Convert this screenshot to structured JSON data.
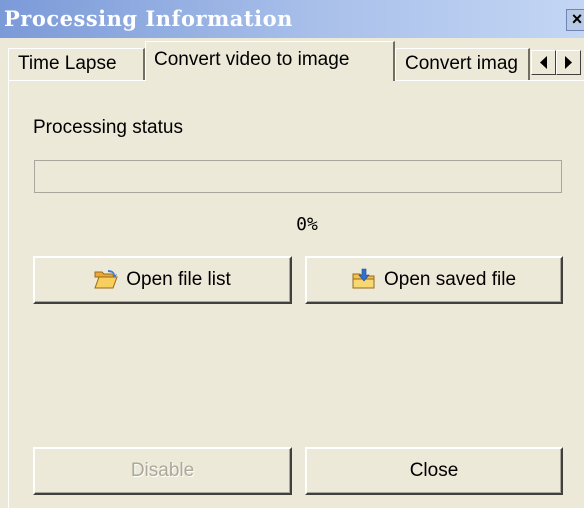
{
  "window": {
    "title": "Processing Information",
    "close_glyph": "×"
  },
  "tabs": [
    {
      "label": "Time Lapse",
      "active": false
    },
    {
      "label": "Convert video to image",
      "active": true
    },
    {
      "label": "Convert imag",
      "active": false
    }
  ],
  "tab_scroll": {
    "left_icon": "arrow-left-icon",
    "right_icon": "arrow-right-icon"
  },
  "status": {
    "label": "Processing status",
    "progress_fraction": 0,
    "percent_text": "0%"
  },
  "buttons": {
    "open_file_list": {
      "label": "Open file list",
      "icon": "open-folder-icon"
    },
    "open_saved_file": {
      "label": "Open saved file",
      "icon": "saved-file-folder-icon"
    },
    "disable": {
      "label": "Disable",
      "enabled": false
    },
    "close": {
      "label": "Close",
      "enabled": true
    }
  },
  "colors": {
    "window_bg": "#ece9d8",
    "title_gradient_start": "#7b9ad8",
    "title_gradient_end": "#c3d6f4",
    "disabled_text": "#aca899"
  }
}
